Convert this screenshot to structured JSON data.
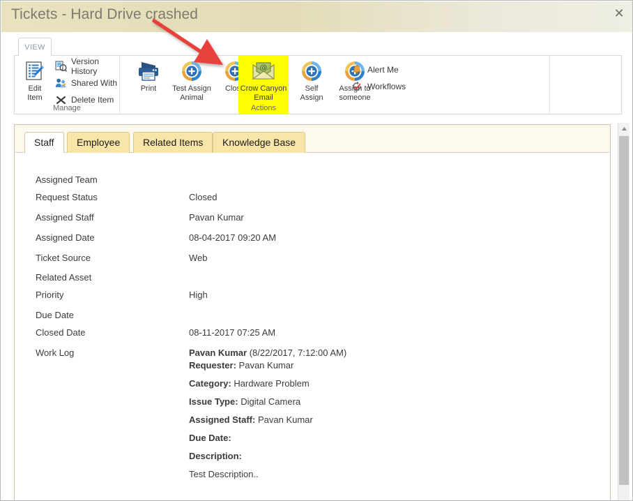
{
  "window": {
    "title": "Tickets - Hard Drive crashed",
    "close_label": "✕",
    "close_icon": "close-icon"
  },
  "ribbon": {
    "tab": "VIEW",
    "groups": [
      {
        "name": "Manage",
        "label": "Manage",
        "highlighted": false
      },
      {
        "name": "Actions",
        "label": "Actions",
        "highlighted": true
      }
    ],
    "manage": {
      "edit_item": {
        "label_line1": "Edit",
        "label_line2": "Item",
        "icon": "edit-item-icon"
      },
      "small_items": [
        {
          "label": "Version History",
          "icon": "version-history-icon"
        },
        {
          "label": "Shared With",
          "icon": "shared-with-icon"
        },
        {
          "label": "Delete Item",
          "icon": "delete-item-icon"
        }
      ]
    },
    "actions": {
      "big_items": [
        {
          "label_line1": "Print",
          "label_line2": "",
          "icon": "print-icon",
          "highlighted": false
        },
        {
          "label_line1": "Test Assign",
          "label_line2": "Animal",
          "icon": "assign-refresh-icon",
          "highlighted": false
        },
        {
          "label_line1": "Close",
          "label_line2": "",
          "icon": "assign-refresh-icon",
          "highlighted": false
        },
        {
          "label_line1": "Crow Canyon",
          "label_line2": "Email",
          "icon": "email-at-icon",
          "highlighted": true
        },
        {
          "label_line1": "Self",
          "label_line2": "Assign",
          "icon": "assign-refresh-icon",
          "highlighted": false
        },
        {
          "label_line1": "Assign to",
          "label_line2": "someone",
          "icon": "assign-refresh-icon",
          "highlighted": false
        }
      ],
      "small_items": [
        {
          "label": "Alert Me",
          "icon": "bell-icon"
        },
        {
          "label": "Workflows",
          "icon": "workflows-icon"
        }
      ]
    }
  },
  "annotation": {
    "arrow": "red-arrow-pointer",
    "color": "#e8403a"
  },
  "form": {
    "tabs": [
      {
        "label": "Staff",
        "active": true
      },
      {
        "label": "Employee",
        "active": false
      },
      {
        "label": "Related Items",
        "active": false
      },
      {
        "label": "Knowledge Base",
        "active": false
      }
    ],
    "fields": [
      {
        "label": "Assigned Team",
        "value": ""
      },
      {
        "label": "Request Status",
        "value": "Closed"
      },
      {
        "label": "Assigned Staff",
        "value": "Pavan Kumar"
      },
      {
        "label": "Assigned Date",
        "value": "08-04-2017 09:20 AM"
      },
      {
        "label": "Ticket Source",
        "value": "Web"
      },
      {
        "label": "Related Asset",
        "value": ""
      },
      {
        "label": "Priority",
        "value": "High"
      },
      {
        "label": "Due Date",
        "value": ""
      },
      {
        "label": "Closed Date",
        "value": "08-11-2017 07:25 AM"
      }
    ],
    "work_log": {
      "label": "Work Log",
      "author": "Pavan Kumar",
      "timestamp": "(8/22/2017, 7:12:00 AM)",
      "entries": [
        {
          "key": "Requester:",
          "value": "Pavan Kumar"
        },
        {
          "key": "Category:",
          "value": "Hardware Problem"
        },
        {
          "key": "Issue Type:",
          "value": "Digital Camera"
        },
        {
          "key": "Assigned Staff:",
          "value": "Pavan Kumar"
        },
        {
          "key": "Due Date:",
          "value": ""
        },
        {
          "key": "Description:",
          "value": ""
        }
      ],
      "description_text": "Test Description.."
    }
  },
  "scrollbar": {
    "up_arrow": "scroll-up-icon"
  }
}
